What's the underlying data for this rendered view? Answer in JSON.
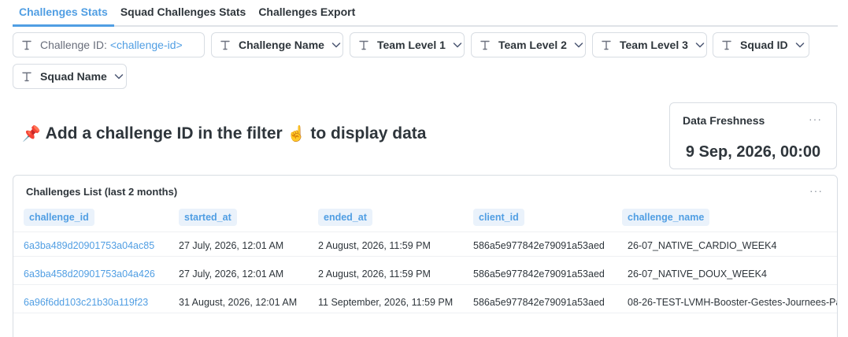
{
  "tabs": [
    {
      "label": "Challenges Stats",
      "active": true
    },
    {
      "label": "Squad Challenges Stats",
      "active": false
    },
    {
      "label": "Challenges Export",
      "active": false
    }
  ],
  "filters": {
    "challenge_id": {
      "name": "Challenge ID:",
      "value": "<challenge-id>"
    },
    "challenge_name": "Challenge Name",
    "team_level_1": "Team Level 1",
    "team_level_2": "Team Level 2",
    "team_level_3": "Team Level 3",
    "squad_id": "Squad ID",
    "squad_name": "Squad Name"
  },
  "heading": {
    "pin_emoji": "📌",
    "text_before": "Add a challenge ID in the filter",
    "finger_emoji": "☝️",
    "text_after": "to display data"
  },
  "freshness": {
    "title": "Data Freshness",
    "value": "9 Sep, 2026, 00:00",
    "menu": "···"
  },
  "table": {
    "title": "Challenges List (last 2 months)",
    "menu": "···",
    "columns": [
      "challenge_id",
      "started_at",
      "ended_at",
      "client_id",
      "challenge_name"
    ],
    "rows": [
      [
        "6a3ba489d20901753a04ac85",
        "27 July, 2026, 12:01 AM",
        "2 August, 2026, 11:59 PM",
        "586a5e977842e79091a53aed",
        "26-07_NATIVE_CARDIO_WEEK4"
      ],
      [
        "6a3ba458d20901753a04a426",
        "27 July, 2026, 12:01 AM",
        "2 August, 2026, 11:59 PM",
        "586a5e977842e79091a53aed",
        "26-07_NATIVE_DOUX_WEEK4"
      ],
      [
        "6a96f6dd103c21b30a119f23",
        "31 August, 2026, 12:01 AM",
        "11 September, 2026, 11:59 PM",
        "586a5e977842e79091a53aed",
        "08-26-TEST-LVMH-Booster-Gestes-Journees-Pa"
      ]
    ]
  },
  "colors": {
    "accent": "#509ee3",
    "text": "#2e353b",
    "border": "#d8dde3",
    "header_bg": "#eaf2fb"
  },
  "icons": [
    "text-type-icon",
    "chevron-down-icon",
    "more-menu-icon"
  ]
}
